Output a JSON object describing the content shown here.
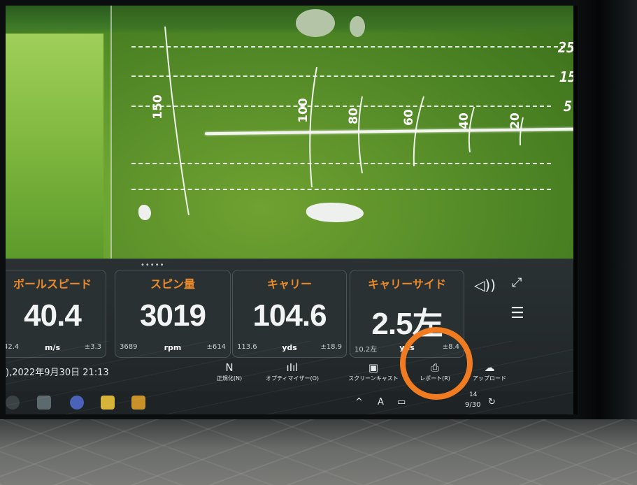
{
  "distance_markers": [
    "150",
    "100",
    "80",
    "60",
    "40",
    "20"
  ],
  "side_markers": [
    "25",
    "15",
    "5"
  ],
  "stats": [
    {
      "title": "ボールスピード",
      "value": "40.4",
      "left": "42.4",
      "unit": "m/s",
      "right": "±3.3"
    },
    {
      "title": "スピン量",
      "value": "3019",
      "left": "3689",
      "unit": "rpm",
      "right": "±614"
    },
    {
      "title": "キャリー",
      "value": "104.6",
      "left": "113.6",
      "unit": "yds",
      "right": "±18.9"
    },
    {
      "title": "キャリーサイド",
      "value": "2.5左",
      "left": "10.2左",
      "unit": "yds",
      "right": "±8.4"
    }
  ],
  "date_text": "),2022年9月30日 21:13",
  "tools": [
    {
      "icon": "N",
      "label": "正規化(N)"
    },
    {
      "icon": "ıIıl",
      "label": "オプティマイザー(O)"
    },
    {
      "icon": "▣",
      "label": "スクリーンキャスト"
    },
    {
      "icon": "⎙",
      "label": "レポート(R)"
    },
    {
      "icon": "☁",
      "label": "アップロード"
    }
  ],
  "tray": {
    "chevron": "^",
    "ime": "A",
    "date": "9/30",
    "time": "14"
  },
  "drag_handle": "•••••",
  "colors": {
    "accent_orange": "#ec8a2a",
    "highlight_circle": "#f07b20"
  }
}
